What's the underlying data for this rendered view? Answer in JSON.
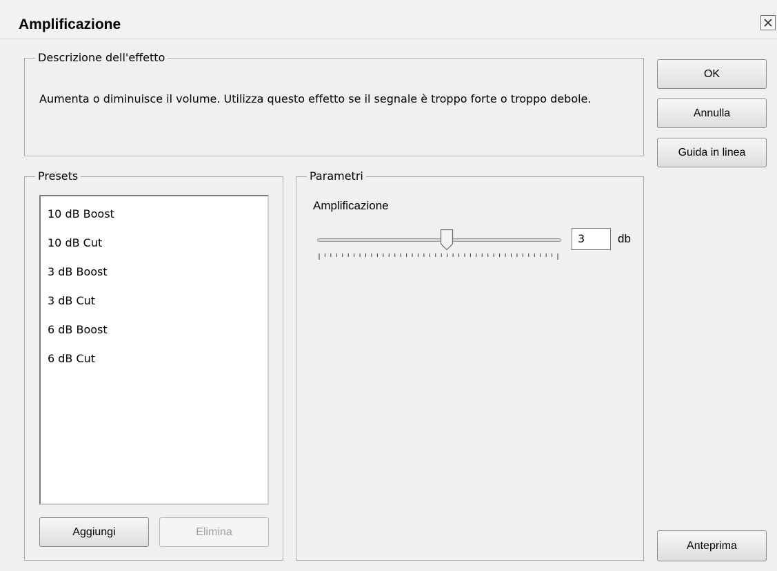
{
  "window": {
    "title": "Amplificazione",
    "close_label": "X"
  },
  "description": {
    "legend": "Descrizione dell'effetto",
    "text": "Aumenta o diminuisce il volume. Utilizza questo effetto se il segnale è troppo forte o troppo debole."
  },
  "buttons": {
    "ok": "OK",
    "cancel": "Annulla",
    "help": "Guida in linea",
    "preview": "Anteprima"
  },
  "presets": {
    "legend": "Presets",
    "items": [
      "10 dB Boost",
      "10 dB Cut",
      "3 dB Boost",
      "3 dB Cut",
      "6 dB Boost",
      "6 dB Cut"
    ],
    "add_label": "Aggiungi",
    "delete_label": "Elimina"
  },
  "parameters": {
    "legend": "Parametri",
    "amplification_label": "Amplificazione",
    "value": "3",
    "unit": "db",
    "slider_fraction": 0.52
  }
}
